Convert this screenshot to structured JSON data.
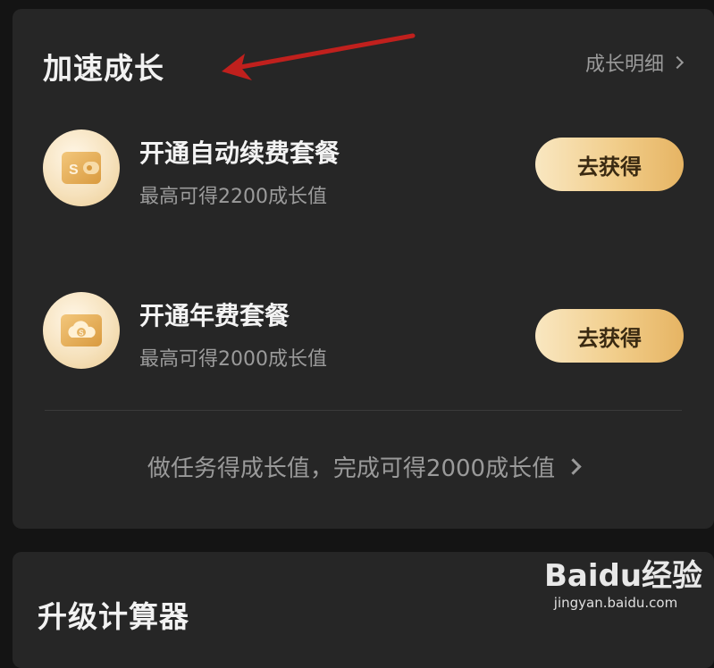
{
  "accelerate_section": {
    "title": "加速成长",
    "detail_link_label": "成长明细",
    "tasks": [
      {
        "title": "开通自动续费套餐",
        "subtitle": "最高可得2200成长值",
        "button_label": "去获得",
        "icon": "wallet-icon"
      },
      {
        "title": "开通年费套餐",
        "subtitle": "最高可得2000成长值",
        "button_label": "去获得",
        "icon": "cloud-coin-icon"
      }
    ],
    "footer_link_label": "做任务得成长值，完成可得2000成长值"
  },
  "calculator_section": {
    "title": "升级计算器"
  },
  "watermark": {
    "brand": "Baidu经验",
    "url": "jingyan.baidu.com"
  },
  "colors": {
    "background": "#141414",
    "card": "#262626",
    "button_gold_start": "#f9e7c1",
    "button_gold_end": "#e6b463",
    "annotation_arrow": "#c0201d"
  }
}
